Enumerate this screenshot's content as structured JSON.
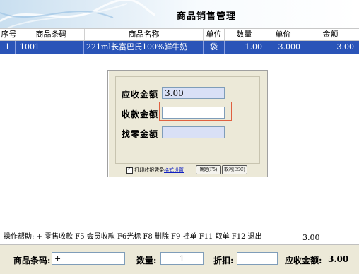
{
  "header": {
    "title": "商品销售管理"
  },
  "table": {
    "columns": [
      "序号",
      "商品条码",
      "商品名称",
      "单位",
      "数量",
      "单价",
      "金额"
    ],
    "rows": [
      {
        "no": "1",
        "barcode": "1001",
        "name": "221ml长富巴氏100%鲜牛奶",
        "unit": "袋",
        "qty": "1.00",
        "price": "3.000",
        "amount": "3.00"
      }
    ]
  },
  "dialog": {
    "receivable_label": "应收金额",
    "receivable_value": "3.00",
    "received_label": "收款金额",
    "received_value": "",
    "change_label": "找零金额",
    "change_value": "",
    "print_receipt_label": "打印收银凭条",
    "format_link": "格式设置",
    "confirm_button": "确定(F5)",
    "cancel_button": "取消(ESC)"
  },
  "help_text": "操作帮助: + 零售收款 F5 会员收款 F6光标 F8 删除 F9 挂单 F11 取单 F12 退出",
  "summary_total": "3.00",
  "bottom": {
    "barcode_label": "商品条码:",
    "barcode_value": "+",
    "qty_label": "数量:",
    "qty_value": "1",
    "discount_label": "折扣:",
    "discount_value": "",
    "receivable_label": "应收金额:",
    "receivable_value": "3.00"
  }
}
